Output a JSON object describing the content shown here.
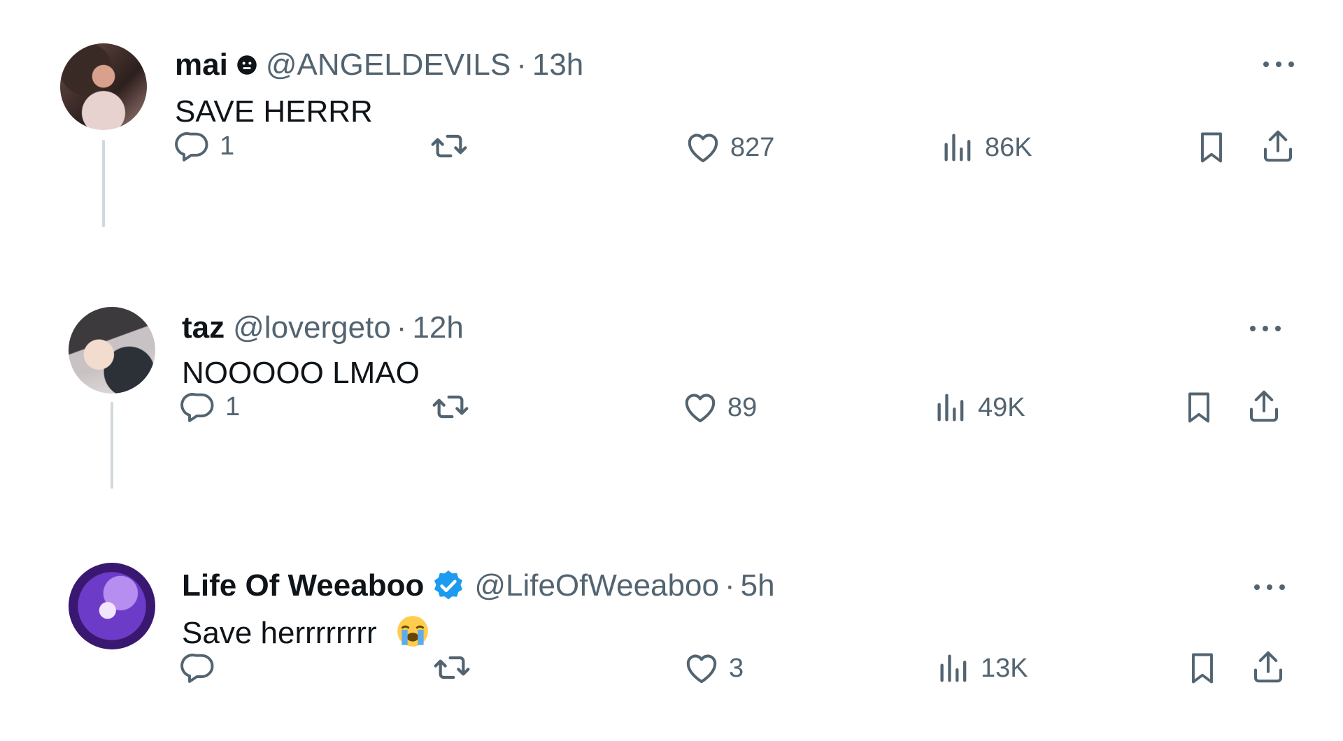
{
  "tweets": [
    {
      "name": "mai",
      "handle": "@ANGELDEVILS",
      "separator": "·",
      "time": "13h",
      "text": "SAVE HERRR",
      "badge_icon": "face-emoji-icon",
      "verified": false,
      "replies": "1",
      "retweets": "",
      "likes": "827",
      "views": "86K"
    },
    {
      "name": "taz",
      "handle": "@lovergeto",
      "separator": "·",
      "time": "12h",
      "text": "NOOOOO LMAO",
      "verified": false,
      "replies": "1",
      "retweets": "",
      "likes": "89",
      "views": "49K"
    },
    {
      "name": "Life Of Weeaboo",
      "handle": "@LifeOfWeeaboo",
      "separator": "·",
      "time": "5h",
      "text": "Save herrrrrrrr",
      "text_emoji": "loudly-crying-face-icon",
      "verified": true,
      "verified_color": "#1d9bf0",
      "replies": "",
      "retweets": "",
      "likes": "3",
      "views": "13K"
    }
  ],
  "colors": {
    "text_primary": "#0f1419",
    "text_secondary": "#536471",
    "thread_line": "#cfd9de",
    "background": "#ffffff"
  }
}
